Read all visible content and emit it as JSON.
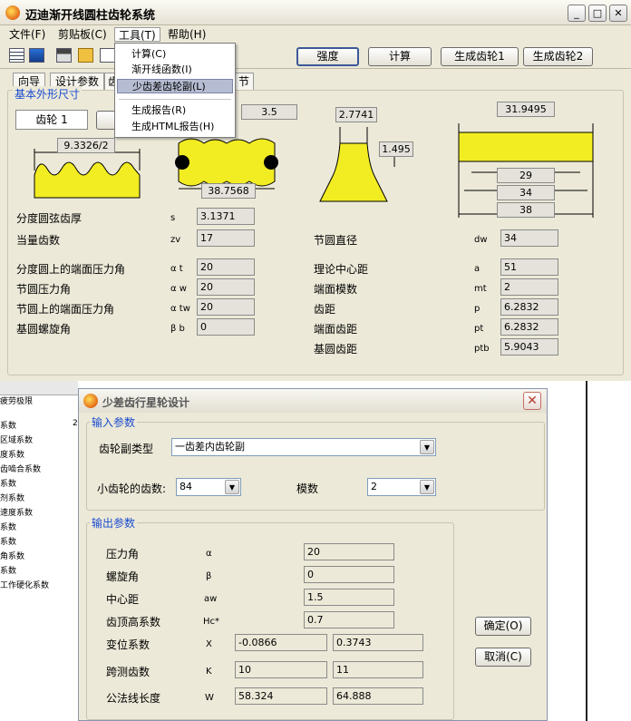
{
  "window": {
    "title": "迈迪渐开线圆柱齿轮系统",
    "controls": {
      "minimize": "_",
      "maximize": "□",
      "close": "✕"
    }
  },
  "menubar": {
    "items": [
      {
        "label": "文件(F)"
      },
      {
        "label": "剪贴板(C)"
      },
      {
        "label": "工具(T)"
      },
      {
        "label": "帮助(H)"
      }
    ]
  },
  "tools_menu": {
    "items": [
      "计算(C)",
      "渐开线函数(I)",
      "少齿差齿轮副(L)",
      "生成报告(R)",
      "生成HTML报告(H)"
    ],
    "highlighted": "少齿差齿轮副(L)"
  },
  "toolbar": {
    "buttons": [
      "强度",
      "计算",
      "生成齿轮1",
      "生成齿轮2"
    ]
  },
  "tabs": [
    "向导",
    "设计参数",
    "齿",
    "节"
  ],
  "basic_group": {
    "label": "基本外形尺寸",
    "gear_selector": "齿轮 1",
    "dims": {
      "tooth_pitch": "9.3326/2",
      "top_value": "3.5",
      "span": "38.7568",
      "tooth_top": "2.7741",
      "tooth_h": "1.495",
      "width_top": "31.9495",
      "w29": "29",
      "w34": "34",
      "w38": "38"
    }
  },
  "params": {
    "left": [
      {
        "label": "分度圆弦齿厚",
        "sym": "s",
        "value": "3.1371"
      },
      {
        "label": "当量齿数",
        "sym": "zv",
        "value": "17"
      },
      {
        "label": "分度圆上的端面压力角",
        "sym": "α t",
        "value": "20"
      },
      {
        "label": "节圆压力角",
        "sym": "α w",
        "value": "20"
      },
      {
        "label": "节圆上的端面压力角",
        "sym": "α tw",
        "value": "20"
      },
      {
        "label": "基圆螺旋角",
        "sym": "β b",
        "value": "0"
      }
    ],
    "right": [
      {
        "label": "节圆直径",
        "sym": "dw",
        "value": "34"
      },
      {
        "label": "理论中心距",
        "sym": "a",
        "value": "51"
      },
      {
        "label": "端面模数",
        "sym": "mt",
        "value": "2"
      },
      {
        "label": "齿距",
        "sym": "p",
        "value": "6.2832"
      },
      {
        "label": "端面齿距",
        "sym": "pt",
        "value": "6.2832"
      },
      {
        "label": "基圆齿距",
        "sym": "ptb",
        "value": "5.9043"
      }
    ]
  },
  "background_window": {
    "items": [
      "疲劳极限",
      "系数",
      "区域系数",
      "度系数",
      "齿啮合系数",
      "系数",
      "剂系数",
      "速度系数",
      "系数",
      "系数",
      "角系数",
      "系数",
      "工作硬化系数"
    ],
    "col_marker": "2"
  },
  "dialog": {
    "title": "少差齿行星轮设计",
    "input_group": "输入参数",
    "pair_type_label": "齿轮副类型",
    "pair_type_value": "一齿差内齿轮副",
    "teeth_label": "小齿轮的齿数:",
    "teeth_value": "84",
    "module_label": "模数",
    "module_value": "2",
    "output_group": "输出参数",
    "outputs": [
      {
        "label": "压力角",
        "sym": "α",
        "v1": "20",
        "v2": null
      },
      {
        "label": "螺旋角",
        "sym": "β",
        "v1": "0",
        "v2": null
      },
      {
        "label": "中心距",
        "sym": "aw",
        "v1": "1.5",
        "v2": null
      },
      {
        "label": "齿顶高系数",
        "sym": "Hc*",
        "v1": "0.7",
        "v2": null
      },
      {
        "label": "变位系数",
        "sym": "X",
        "v1": "-0.0866",
        "v2": "0.3743"
      },
      {
        "label": "跨测齿数",
        "sym": "K",
        "v1": "10",
        "v2": "11"
      },
      {
        "label": "公法线长度",
        "sym": "W",
        "v1": "58.324",
        "v2": "64.888"
      }
    ],
    "ok_label": "确定(O)",
    "cancel_label": "取消(C)"
  }
}
